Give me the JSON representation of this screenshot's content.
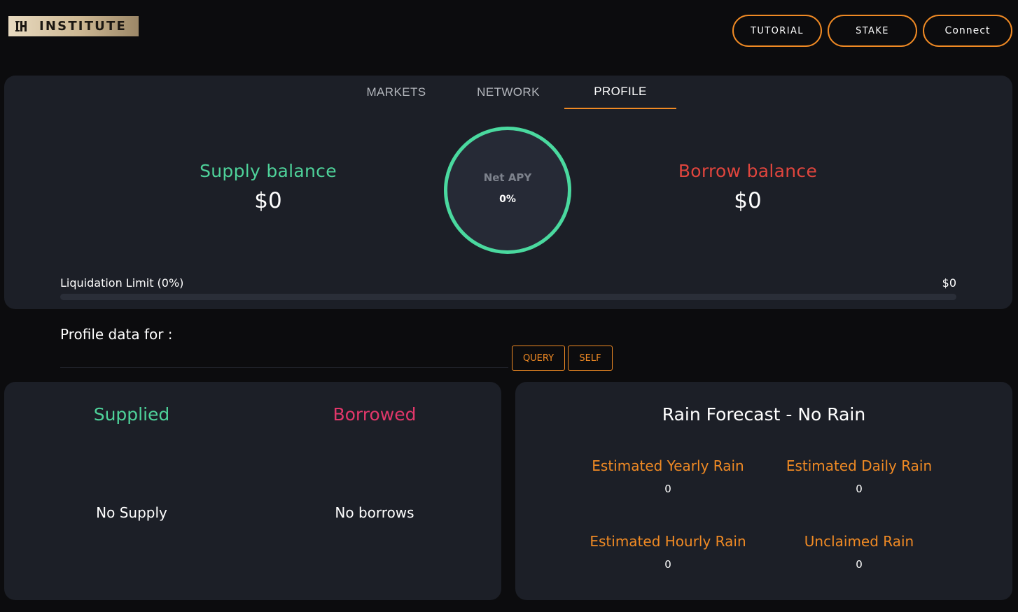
{
  "header": {
    "logo_text": "INSTITUTE",
    "buttons": {
      "tutorial": "TUTORIAL",
      "stake": "STAKE",
      "connect": "Connect"
    }
  },
  "tabs": [
    {
      "label": "MARKETS",
      "active": false
    },
    {
      "label": "NETWORK",
      "active": false
    },
    {
      "label": "PROFILE",
      "active": true
    }
  ],
  "overview": {
    "supply_title": "Supply balance",
    "supply_value": "$0",
    "net_apy_label": "Net APY",
    "net_apy_value": "0%",
    "borrow_title": "Borrow balance",
    "borrow_value": "$0",
    "liquidation_label": "Liquidation Limit (0%)",
    "liquidation_amount": "$0",
    "liquidation_fill_percent": 0
  },
  "profile": {
    "label": "Profile data for :",
    "input_value": "",
    "query_label": "QUERY",
    "self_label": "SELF"
  },
  "positions": {
    "supplied_title": "Supplied",
    "supplied_empty": "No Supply",
    "borrowed_title": "Borrowed",
    "borrowed_empty": "No borrows"
  },
  "rain": {
    "title": "Rain Forecast - No Rain",
    "yearly_label": "Estimated Yearly Rain",
    "yearly_value": "0",
    "daily_label": "Estimated Daily Rain",
    "daily_value": "0",
    "hourly_label": "Estimated Hourly Rain",
    "hourly_value": "0",
    "unclaimed_label": "Unclaimed Rain",
    "unclaimed_value": "0"
  },
  "colors": {
    "accent": "#f08a24",
    "supply_green": "#4ed29a",
    "borrow_red": "#e0453d",
    "borrowed_pink": "#e2376a",
    "panel": "#1c1f27",
    "background": "#0c0c0e"
  },
  "icons": {
    "logo": "institute-logo-icon"
  }
}
